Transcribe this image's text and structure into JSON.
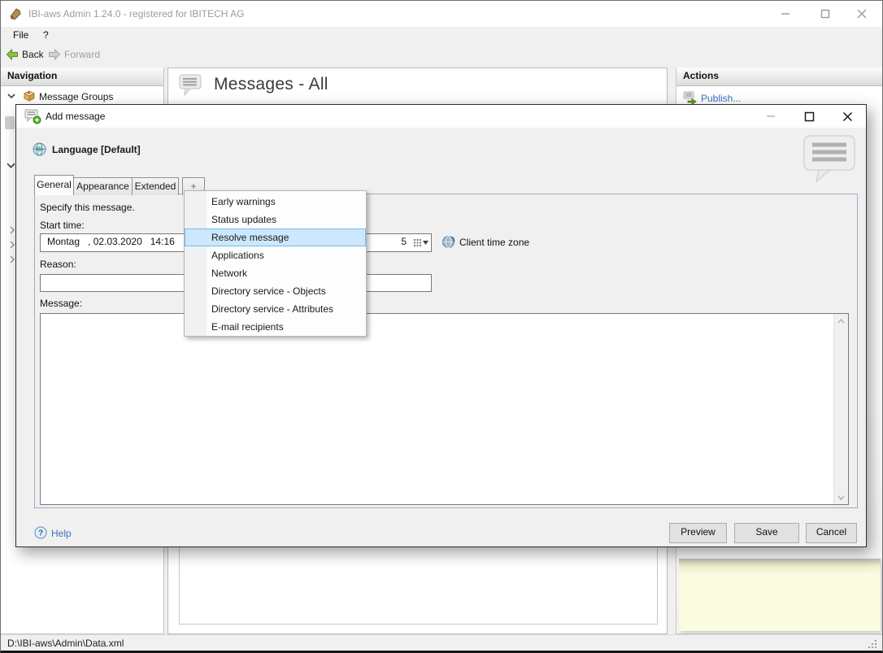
{
  "window": {
    "title": "IBI-aws Admin 1.24.0 - registered for IBITECH AG",
    "menu_items": [
      {
        "label": "File"
      },
      {
        "label": "?"
      }
    ],
    "toolbar": {
      "back": "Back",
      "forward": "Forward"
    },
    "status_path": "D:\\IBI-aws\\Admin\\Data.xml"
  },
  "navigation": {
    "header": "Navigation",
    "root_item": "Message Groups"
  },
  "main": {
    "header": "Messages - All"
  },
  "actions": {
    "header": "Actions",
    "publish_label": "Publish..."
  },
  "dialog": {
    "title": "Add message",
    "language_label": "Language [Default]",
    "tabs": [
      {
        "label": "General",
        "selected": true
      },
      {
        "label": "Appearance",
        "selected": false
      },
      {
        "label": "Extended",
        "selected": false
      },
      {
        "label": "+",
        "selected": false
      }
    ],
    "general_tab": {
      "instruction": "Specify this message.",
      "start_time_label": "Start time:",
      "start_time_value": "Montag   , 02.03.2020   14:16",
      "end_time_visible_fragment": "5",
      "client_time_zone_label": "Client time zone",
      "reason_label": "Reason:",
      "reason_value": "",
      "message_label": "Message:",
      "message_value": ""
    },
    "footer": {
      "help_label": "Help",
      "preview_label": "Preview",
      "save_label": "Save",
      "cancel_label": "Cancel"
    }
  },
  "popup_menu": {
    "items": [
      {
        "label": "Early warnings",
        "highlighted": false
      },
      {
        "label": "Status updates",
        "highlighted": false
      },
      {
        "label": "Resolve message",
        "highlighted": true
      },
      {
        "label": "Applications",
        "highlighted": false
      },
      {
        "label": "Network",
        "highlighted": false
      },
      {
        "label": "Directory service - Objects",
        "highlighted": false
      },
      {
        "label": "Directory service - Attributes",
        "highlighted": false
      },
      {
        "label": "E-mail recipients",
        "highlighted": false
      }
    ]
  },
  "colors": {
    "menu_highlight": "#cbe8ff",
    "menu_highlight_border": "#7cb9e2",
    "link_blue": "#3f6fc0",
    "info_panel_yellow": "#fbfbe2",
    "tab_page_border": "#9ab0c4",
    "back_arrow_green": "#8bc440"
  }
}
